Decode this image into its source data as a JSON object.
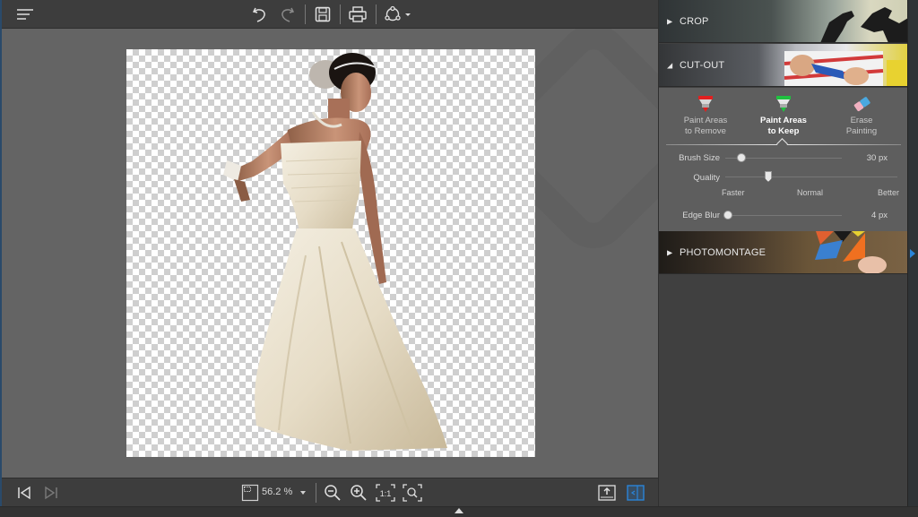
{
  "toolbar": {
    "menu_icon": "hamburger-menu-icon",
    "undo_icon": "undo-icon",
    "redo_icon": "redo-icon",
    "save_icon": "save-icon",
    "print_icon": "print-icon",
    "share_icon": "share-icon"
  },
  "canvas": {
    "image_description": "Bride in white strapless gown on transparent checkerboard background"
  },
  "bottombar": {
    "prev_icon": "previous-image-icon",
    "next_icon": "next-image-icon",
    "fit_icon": "fit-to-window-icon",
    "zoom_level": "56.2 %",
    "zoom_out_icon": "zoom-out-icon",
    "zoom_in_icon": "zoom-in-icon",
    "actual_size_label": "1:1",
    "zoom_fit_icon": "zoom-to-fit-icon",
    "export_icon": "export-icon",
    "panel_toggle_icon": "toggle-panel-icon"
  },
  "panel": {
    "sections": [
      {
        "label": "CROP",
        "expanded": false
      },
      {
        "label": "CUT-OUT",
        "expanded": true
      },
      {
        "label": "PHOTOMONTAGE",
        "expanded": false
      }
    ],
    "cutout": {
      "tools": [
        {
          "line1": "Paint Areas",
          "line2": "to Remove",
          "color": "#e02020",
          "active": false
        },
        {
          "line1": "Paint Areas",
          "line2": "to Keep",
          "color": "#20c040",
          "active": true
        },
        {
          "line1": "Erase",
          "line2": "Painting",
          "color": "#4aa8e0",
          "active": false
        }
      ],
      "brush_size": {
        "label": "Brush Size",
        "value": "30 px",
        "fraction": 0.14
      },
      "quality": {
        "label": "Quality",
        "ticks": [
          "Faster",
          "Normal",
          "Better"
        ],
        "fraction": 0.25
      },
      "edge_blur": {
        "label": "Edge Blur",
        "value": "4 px",
        "fraction": 0.02
      }
    }
  },
  "colors": {
    "accent": "#2a84d8",
    "panel_bg": "#404040",
    "tool_area_bg": "#5e5e5e",
    "canvas_bg": "#646464"
  }
}
